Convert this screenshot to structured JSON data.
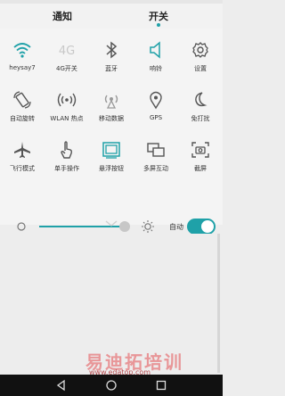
{
  "tabs": {
    "notify_label": "通知",
    "switch_label": "开关",
    "active": "开关"
  },
  "toggles": [
    {
      "label": "heysay7",
      "icon": "wifi-icon",
      "active": true
    },
    {
      "label": "4G开关",
      "icon": "4g-icon",
      "active": false
    },
    {
      "label": "蓝牙",
      "icon": "bluetooth-icon",
      "active": false
    },
    {
      "label": "响铃",
      "icon": "speaker-icon",
      "active": true
    },
    {
      "label": "设置",
      "icon": "gear-icon",
      "active": false
    },
    {
      "label": "自动旋转",
      "icon": "rotate-icon",
      "active": false
    },
    {
      "label": "WLAN 热点",
      "icon": "hotspot-icon",
      "active": false
    },
    {
      "label": "移动数据",
      "icon": "mobile-data-icon",
      "active": false
    },
    {
      "label": "GPS",
      "icon": "location-pin-icon",
      "active": false
    },
    {
      "label": "免打扰",
      "icon": "moon-icon",
      "active": false
    },
    {
      "label": "飞行模式",
      "icon": "airplane-icon",
      "active": false
    },
    {
      "label": "单手操作",
      "icon": "hand-icon",
      "active": false
    },
    {
      "label": "悬浮按钮",
      "icon": "floating-button-icon",
      "active": true
    },
    {
      "label": "多屏互动",
      "icon": "multi-screen-icon",
      "active": false
    },
    {
      "label": "截屏",
      "icon": "screenshot-icon",
      "active": false
    }
  ],
  "brightness": {
    "level": 0.96,
    "auto_label": "自动",
    "auto_on": true
  },
  "watermark": {
    "title": "易迪拓培训",
    "subtitle": "www.edatop.com"
  },
  "colors": {
    "accent": "#1fa1a8",
    "inactive_icon": "#555555",
    "background": "#ededed"
  }
}
